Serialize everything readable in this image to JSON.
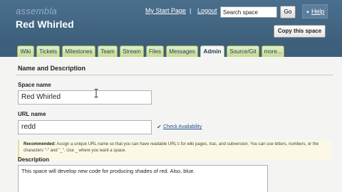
{
  "header": {
    "logo": "assembla",
    "space_title": "Red Whirled",
    "my_start_page": "My Start Page",
    "separator": "|",
    "logout": "Logout",
    "search_placeholder": "Search space",
    "go_label": "Go",
    "help_label": "Help",
    "copy_space_label": "Copy this space"
  },
  "tabs": [
    {
      "label": "Wiki"
    },
    {
      "label": "Tickets"
    },
    {
      "label": "Milestones"
    },
    {
      "label": "Team"
    },
    {
      "label": "Stream"
    },
    {
      "label": "Files"
    },
    {
      "label": "Messages"
    },
    {
      "label": "Admin",
      "active": true
    },
    {
      "label": "Source/Git"
    },
    {
      "label": "more..."
    }
  ],
  "form": {
    "section_title": "Name and Description",
    "space_name_label": "Space name",
    "space_name_value": "Red Whirled",
    "url_name_label": "URL name",
    "url_name_value": "redd",
    "check_availability": "Check Availability",
    "recommended_label": "Recommended:",
    "recommended_text": "Assign a unique URL name so that you can have readable URL's for wiki pages, trac, and subversion. You can use letters, numbers, or the characters \"-\" and \"_\". Use _ where you want a space.",
    "description_label": "Description",
    "description_value": "This space will develop new code for producing shades of red. Also, blue."
  },
  "colors": {
    "header_bg": "#3d5f7b",
    "tab_bg": "#c5db92",
    "content_bg": "#f4f5f3"
  }
}
